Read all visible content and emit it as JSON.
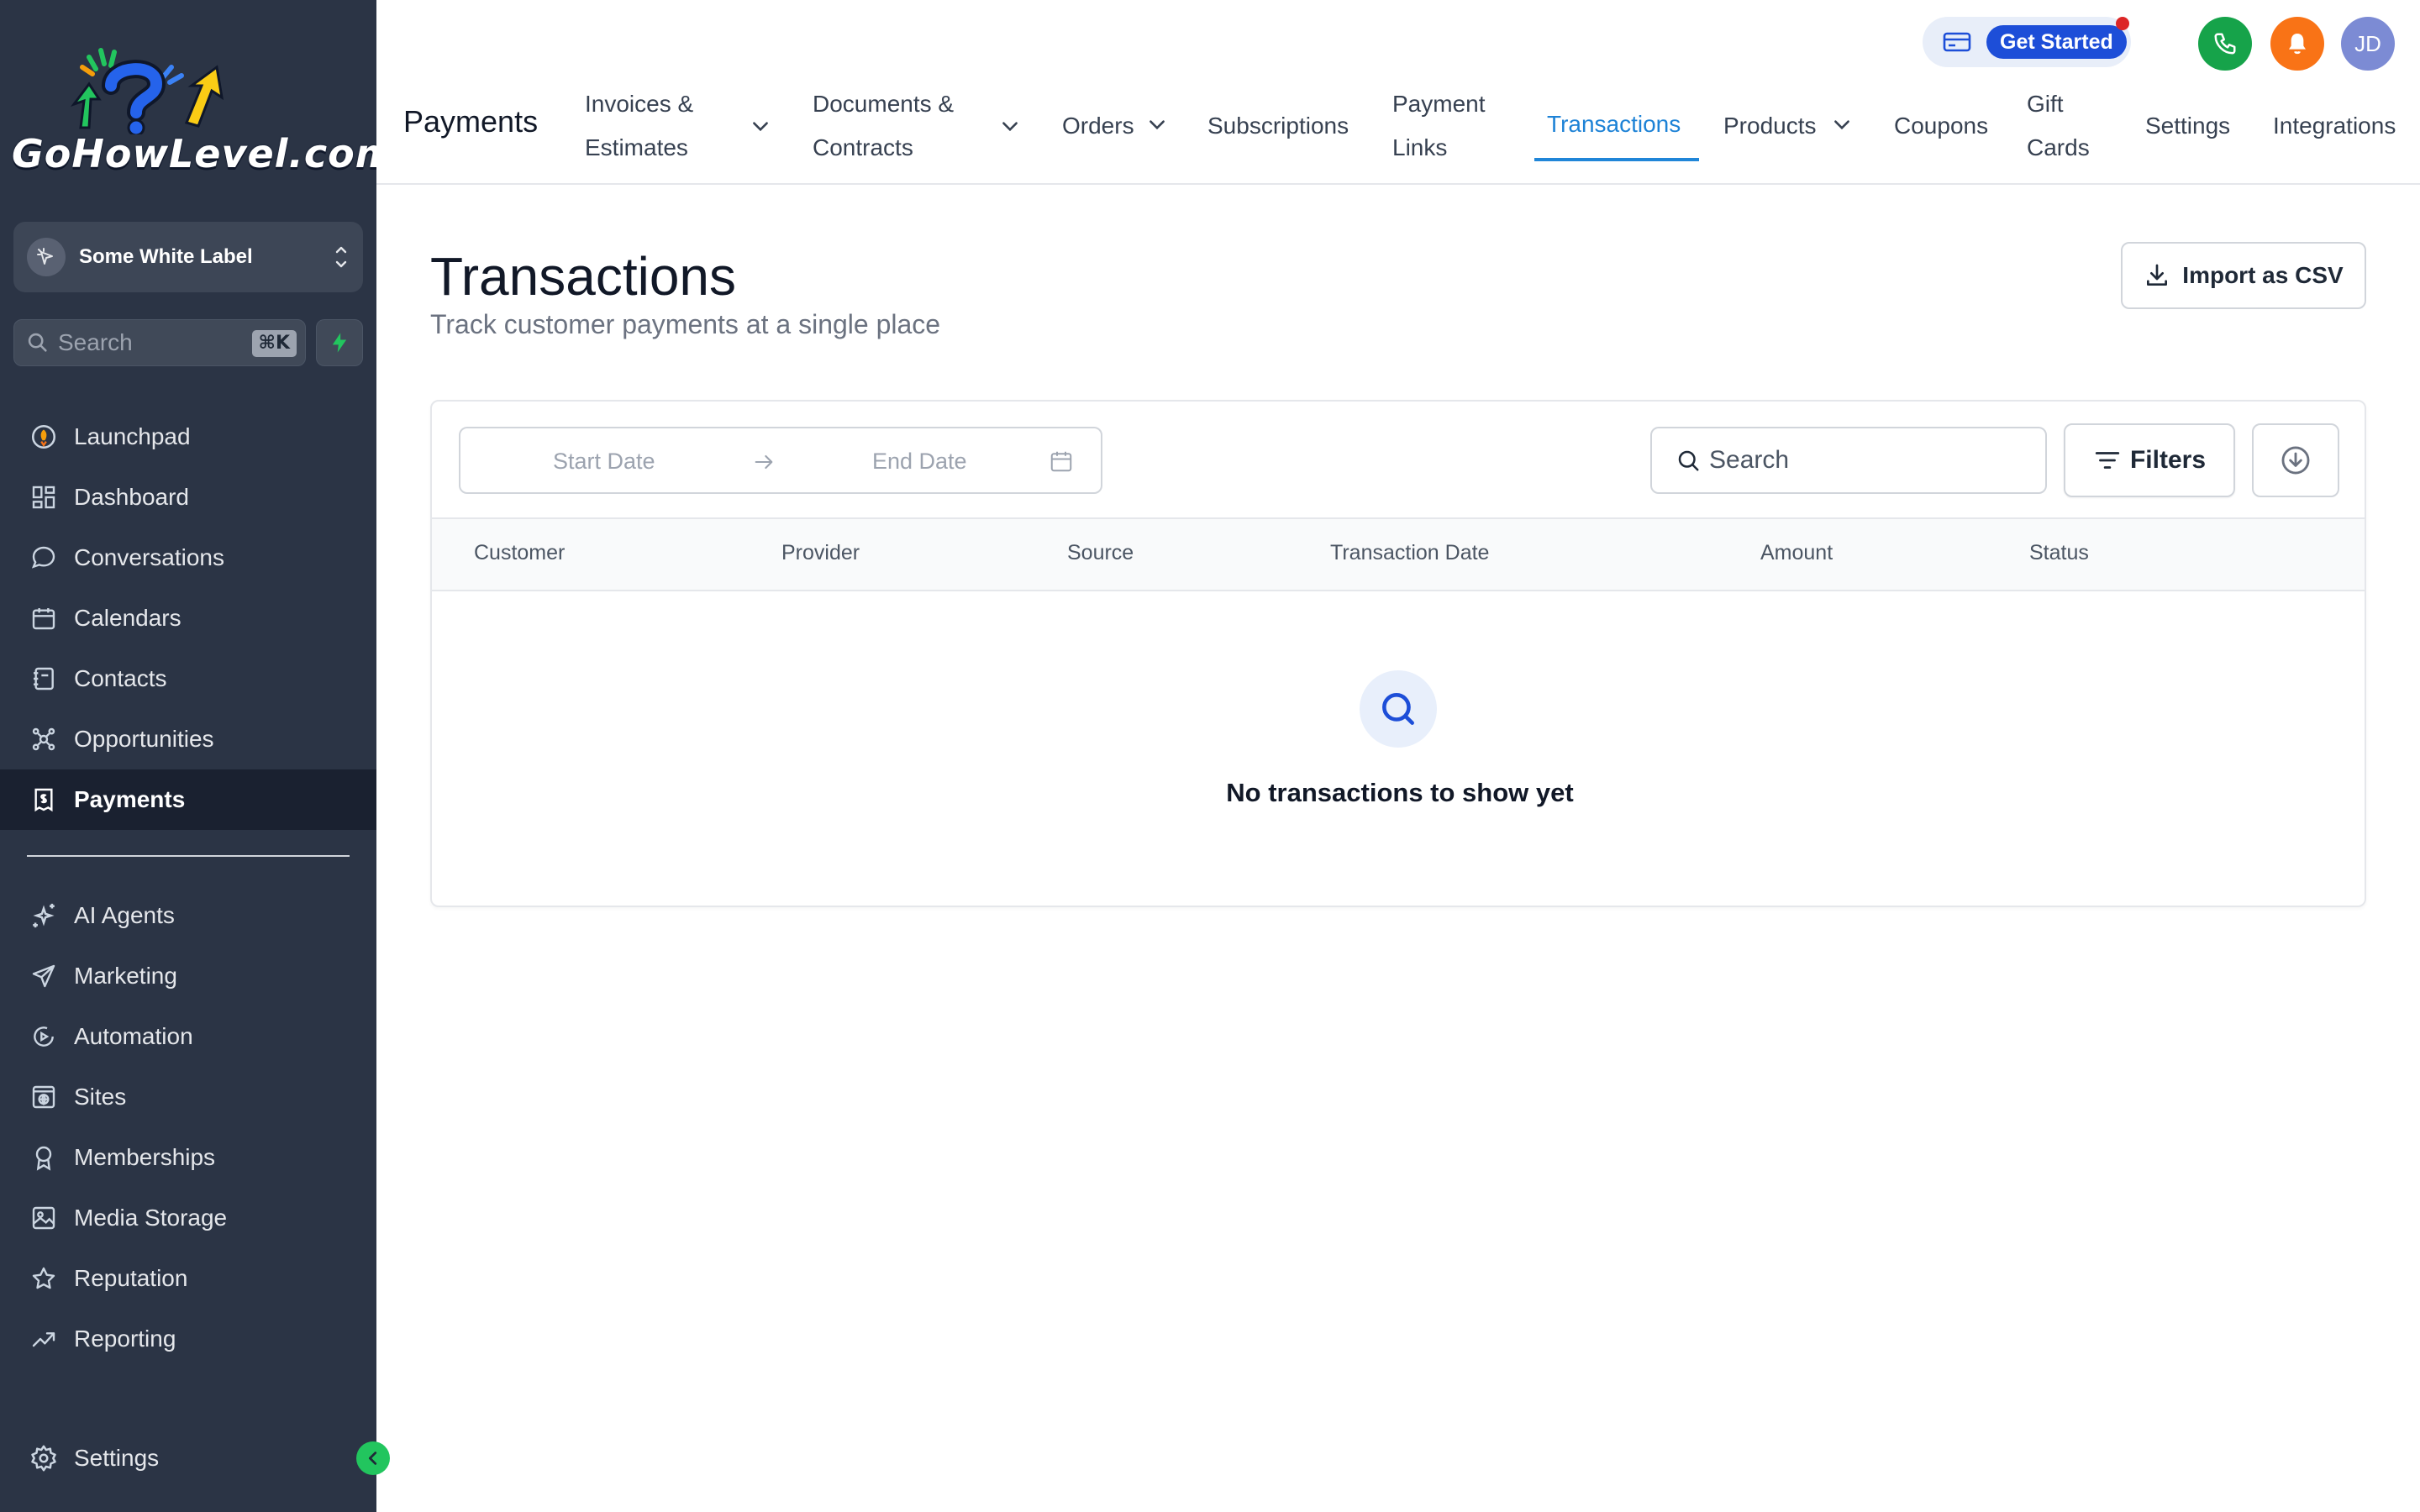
{
  "brand": {
    "logo_text": "GoHowLevel.com"
  },
  "sidebar": {
    "location": {
      "name": "Some White Label"
    },
    "search": {
      "placeholder": "Search",
      "shortcut": "⌘K"
    },
    "nav_primary": [
      {
        "label": "Launchpad",
        "icon": "rocket-icon"
      },
      {
        "label": "Dashboard",
        "icon": "dashboard-grid-icon"
      },
      {
        "label": "Conversations",
        "icon": "chat-bubble-icon"
      },
      {
        "label": "Calendars",
        "icon": "calendar-icon"
      },
      {
        "label": "Contacts",
        "icon": "contact-book-icon"
      },
      {
        "label": "Opportunities",
        "icon": "opportunities-icon"
      },
      {
        "label": "Payments",
        "icon": "payments-receipt-icon",
        "active": true
      }
    ],
    "nav_secondary": [
      {
        "label": "AI Agents",
        "icon": "sparkle-icon"
      },
      {
        "label": "Marketing",
        "icon": "send-icon"
      },
      {
        "label": "Automation",
        "icon": "automation-icon"
      },
      {
        "label": "Sites",
        "icon": "globe-window-icon"
      },
      {
        "label": "Memberships",
        "icon": "award-badge-icon"
      },
      {
        "label": "Media Storage",
        "icon": "image-icon"
      },
      {
        "label": "Reputation",
        "icon": "star-icon"
      },
      {
        "label": "Reporting",
        "icon": "trending-up-icon"
      }
    ],
    "settings_label": "Settings"
  },
  "header": {
    "get_started_label": "Get Started",
    "avatar_initials": "JD",
    "module_title": "Payments",
    "tabs": [
      {
        "line1": "Invoices &",
        "line2": "Estimates",
        "dropdown": true
      },
      {
        "line1": "Documents &",
        "line2": "Contracts",
        "dropdown": true
      },
      {
        "line1": "Orders",
        "dropdown": true
      },
      {
        "line1": "Subscriptions"
      },
      {
        "line1": "Payment",
        "line2": "Links"
      },
      {
        "line1": "Transactions",
        "active": true
      },
      {
        "line1": "Products",
        "dropdown": true
      },
      {
        "line1": "Coupons"
      },
      {
        "line1": "Gift",
        "line2": "Cards"
      },
      {
        "line1": "Settings"
      },
      {
        "line1": "Integrations"
      }
    ]
  },
  "main": {
    "title": "Transactions",
    "subtitle": "Track customer payments at a single place",
    "import_label": "Import as CSV",
    "toolbar": {
      "start_date_placeholder": "Start Date",
      "end_date_placeholder": "End Date",
      "search_placeholder": "Search",
      "filters_label": "Filters"
    },
    "table": {
      "columns": [
        "Customer",
        "Provider",
        "Source",
        "Transaction Date",
        "Amount",
        "Status"
      ],
      "rows": [],
      "empty_message": "No transactions to show yet"
    }
  },
  "colors": {
    "sidebar_bg": "#2b3445",
    "sidebar_active_bg": "#1a2130",
    "accent_blue": "#1d82d6",
    "get_started_blue": "#1d4ed8",
    "phone_green": "#16a34a",
    "bell_orange": "#f97316",
    "collapse_green": "#22c55e"
  }
}
